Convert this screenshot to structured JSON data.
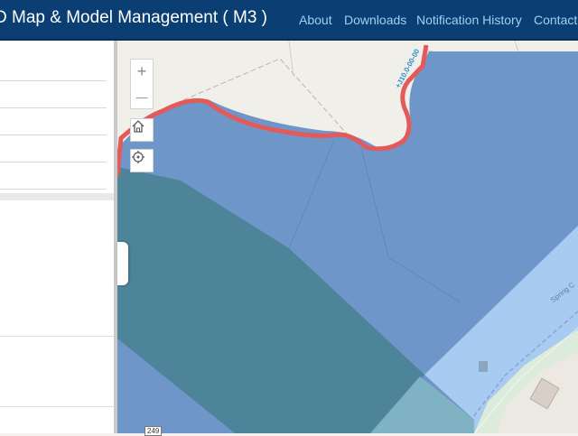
{
  "header": {
    "title": "D Map & Model Management ( M3 )",
    "nav": [
      {
        "label": "About"
      },
      {
        "label": "Downloads"
      },
      {
        "label": "Notification History"
      },
      {
        "label": "Contact"
      }
    ]
  },
  "map": {
    "controls": {
      "zoom_in_symbol": "+",
      "zoom_out_symbol": "—"
    },
    "labels": {
      "road_shield": "249",
      "road_name": "Spring C",
      "contour": "+J10.0-00-00"
    },
    "colors": {
      "flood_zone": "#6f96c8",
      "floodway": "#4d8499",
      "shaded_area": "#a8cbf2",
      "boundary": "#e35a5a",
      "land": "#f1efea"
    }
  }
}
